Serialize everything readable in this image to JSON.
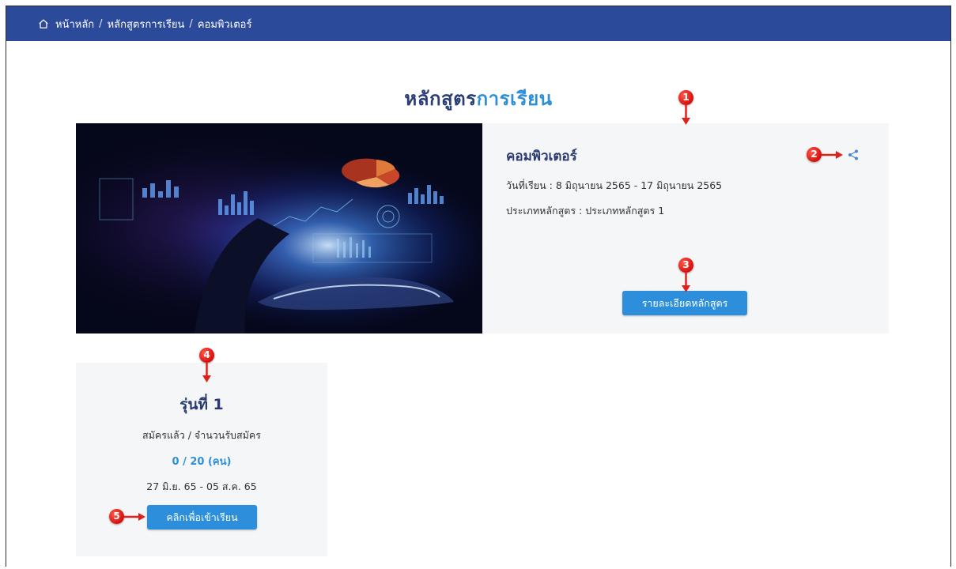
{
  "breadcrumb": {
    "home": "หน้าหลัก",
    "section": "หลักสูตรการเรียน",
    "current": "คอมพิวเตอร์",
    "separator": "/"
  },
  "page_title": {
    "part1": "หลักสูตร",
    "part2": "การเรียน"
  },
  "course": {
    "name": "คอมพิวเตอร์",
    "dates": "วันที่เรียน : 8 มิถุนายน 2565 - 17 มิถุนายน 2565",
    "type": "ประเภทหลักสูตร : ประเภทหลักสูตร 1",
    "detail_button": "รายละเอียดหลักสูตร",
    "share_icon": "share-icon"
  },
  "batch": {
    "title": "รุ่นที่ 1",
    "subtitle": "สมัครแล้ว / จำนวนรับสมัคร",
    "count": "0 / 20 (คน)",
    "dates": "27 มิ.ย. 65 - 05 ส.ค. 65",
    "enter_button": "คลิกเพื่อเข้าเรียน"
  },
  "markers": [
    "1",
    "2",
    "3",
    "4",
    "5"
  ],
  "colors": {
    "topbar": "#2c4a9a",
    "title_dark": "#2a3f7a",
    "title_accent": "#2f8fd6",
    "button": "#2d8fdb",
    "card_bg": "#f5f6f7",
    "marker": "#e0201a"
  }
}
